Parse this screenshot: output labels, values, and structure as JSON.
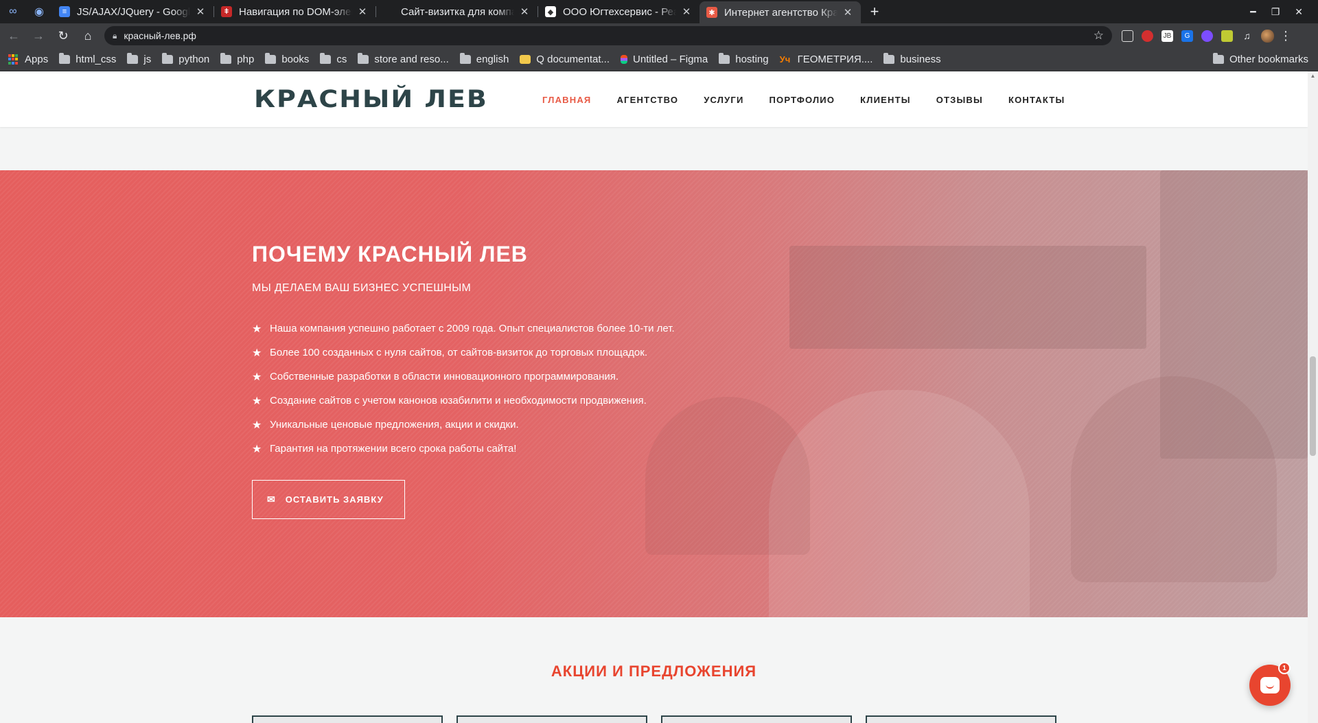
{
  "browser": {
    "tabs": [
      {
        "title": "JS/AJAX/JQuery - Google",
        "favicon_color": "#4285f4",
        "favicon_glyph": "≡",
        "active": false
      },
      {
        "title": "Навигация по DOM-элем",
        "favicon_color": "#c62828",
        "favicon_glyph": "ǂ",
        "active": false
      },
      {
        "title": "Сайт-визитка для компа",
        "favicon_color": "#1f2022",
        "favicon_glyph": "",
        "active": false
      },
      {
        "title": "ООО Югтехсервис - Реал",
        "favicon_color": "#ffffff",
        "favicon_glyph": "◆",
        "active": false
      },
      {
        "title": "Интернет агентство Крас",
        "favicon_color": "#e85a45",
        "favicon_glyph": "✱",
        "active": true
      }
    ],
    "new_tab": "+",
    "url": "красный-лев.рф",
    "bookmarks": [
      {
        "label": "Apps",
        "type": "apps"
      },
      {
        "label": "html_css",
        "type": "folder"
      },
      {
        "label": "js",
        "type": "folder"
      },
      {
        "label": "python",
        "type": "folder"
      },
      {
        "label": "php",
        "type": "folder"
      },
      {
        "label": "books",
        "type": "folder"
      },
      {
        "label": "cs",
        "type": "folder"
      },
      {
        "label": "store and reso...",
        "type": "folder"
      },
      {
        "label": "english",
        "type": "folder"
      },
      {
        "label": "Q documentat...",
        "type": "site"
      },
      {
        "label": "Untitled – Figma",
        "type": "figma"
      },
      {
        "label": "hosting",
        "type": "folder"
      },
      {
        "label": "ГЕОМЕТРИЯ....",
        "type": "uch"
      },
      {
        "label": "business",
        "type": "folder"
      }
    ],
    "other_bookmarks": "Other bookmarks"
  },
  "site": {
    "logo": "КРАСНЫЙ ЛЕВ",
    "nav": [
      "ГЛАВНАЯ",
      "АГЕНТСТВО",
      "УСЛУГИ",
      "ПОРТФОЛИО",
      "КЛИЕНТЫ",
      "ОТЗЫВЫ",
      "КОНТАКТЫ"
    ],
    "nav_active": "ГЛАВНАЯ",
    "accent_color": "#e85a45",
    "hero": {
      "title": "ПОЧЕМУ КРАСНЫЙ ЛЕВ",
      "subtitle": "МЫ ДЕЛАЕМ ВАШ БИЗНЕС УСПЕШНЫМ",
      "features": [
        "Наша компания успешно работает с 2009 года. Опыт специалистов более 10-ти лет.",
        "Более 100 созданных с нуля сайтов, от сайтов-визиток до торговых площадок.",
        "Собственные разработки в области инновационного программирования.",
        "Создание сайтов с учетом канонов юзабилити и необходимости продвижения.",
        "Уникальные ценовые предложения, акции и скидки.",
        "Гарантия на протяжении всего срока работы сайта!"
      ],
      "cta_label": "ОСТАВИТЬ ЗАЯВКУ"
    },
    "promo_title": "АКЦИИ И ПРЕДЛОЖЕНИЯ",
    "chat_badge": "1"
  }
}
